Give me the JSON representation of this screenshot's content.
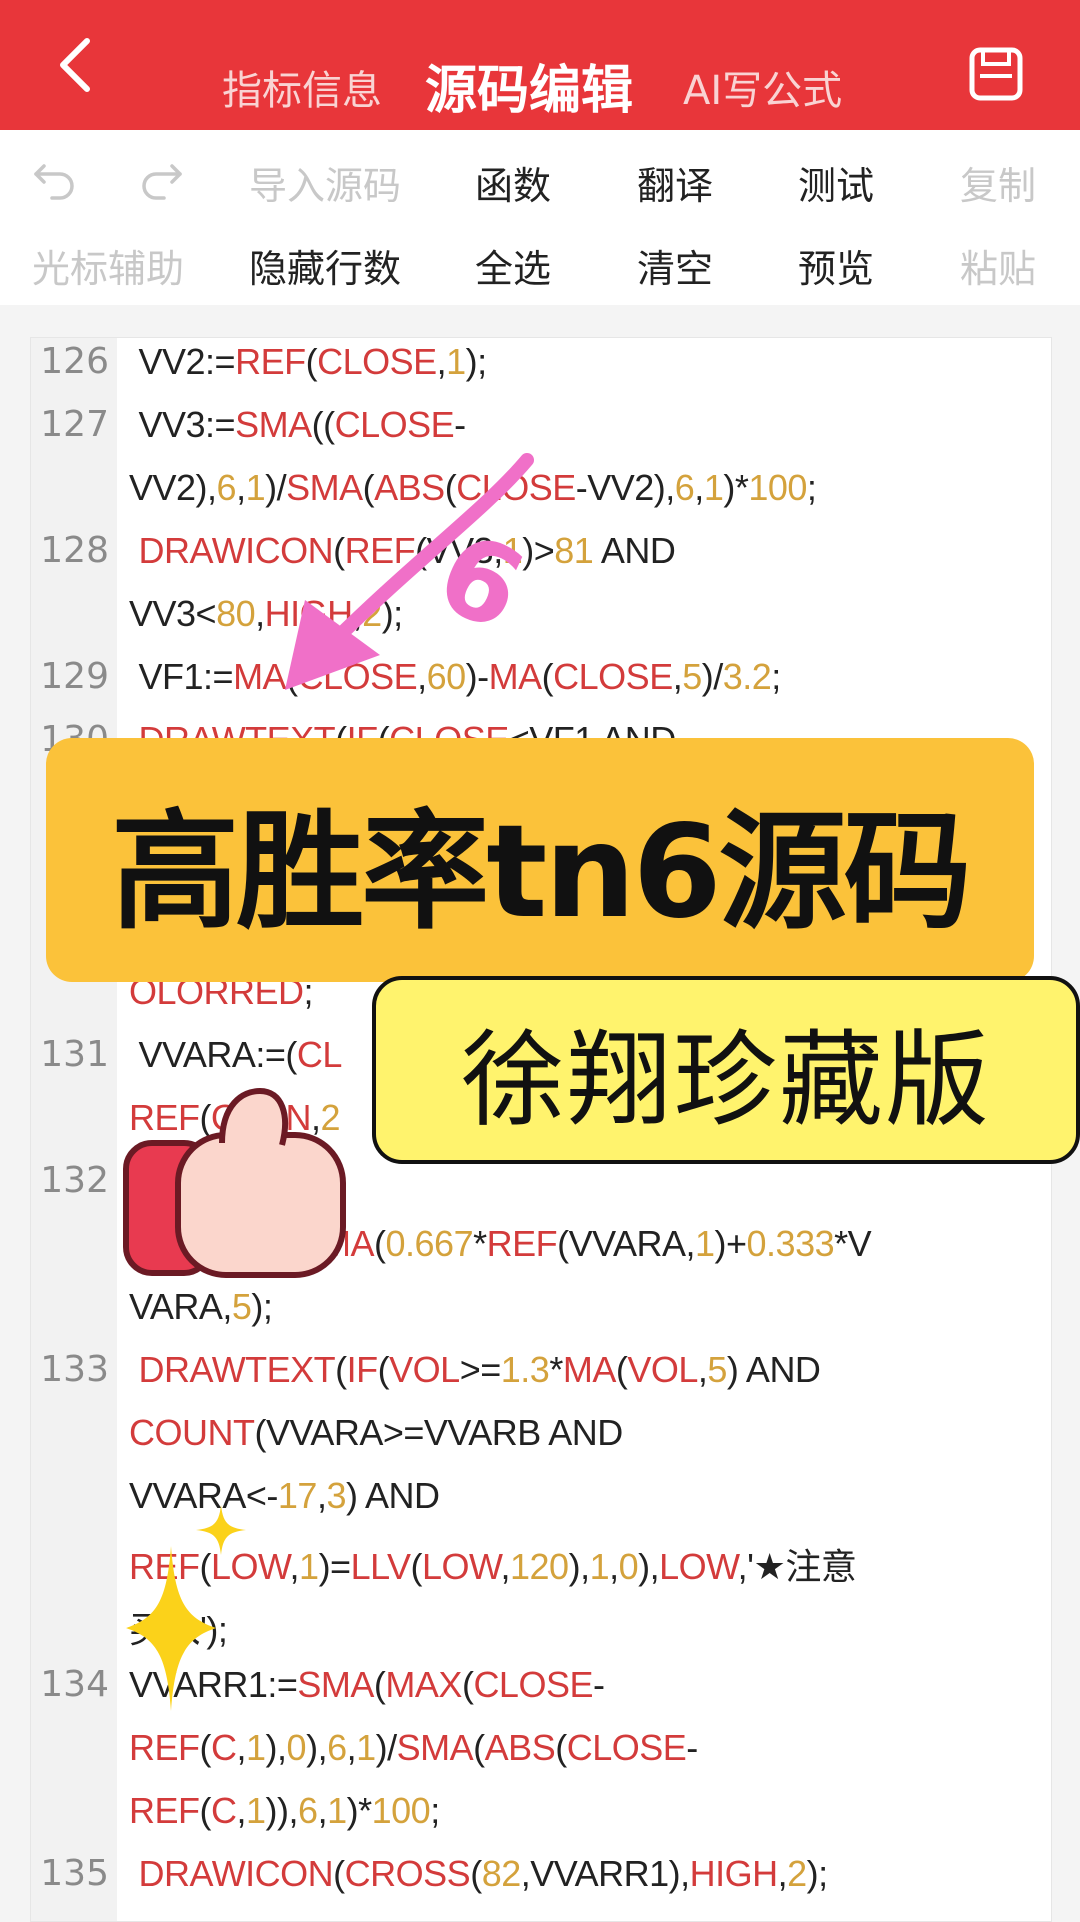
{
  "header": {
    "tabs": [
      "指标信息",
      "源码编辑",
      "AI写公式"
    ]
  },
  "toolbar": {
    "row1": [
      "导入源码",
      "函数",
      "翻译",
      "测试",
      "复制"
    ],
    "row2": [
      "光标辅助",
      "隐藏行数",
      "全选",
      "清空",
      "预览",
      "粘贴"
    ]
  },
  "editor": {
    "line_numbers": [
      "126",
      "127",
      "128",
      "129",
      "130",
      "131",
      "132",
      "133",
      "134",
      "135"
    ],
    "lines": [
      " VV2:=REF(CLOSE,1);",
      " VV3:=SMA((CLOSE-",
      "VV2),6,1)/SMA(ABS(CLOSE-VV2),6,1)*100;",
      " DRAWICON(REF(VV3,1)>81 AND",
      "VV3<80,HIGH,2);",
      " VF1:=MA(CLOSE,60)-MA(CLOSE,5)/3.2;",
      " DRAWTEXT(IF(CLOSE<VF1 AND",
      "OLORRED;",
      " VVARA:=(CL",
      "REF(OPEN,2",
      "MA(0.667*REF(VVARA,1)+0.333*V",
      "VARA,5);",
      " DRAWTEXT(IF(VOL>=1.3*MA(VOL,5) AND",
      "COUNT(VVARA>=VVARB AND",
      "VVARA<-17,3) AND",
      "REF(LOW,1)=LLV(LOW,120),1,0),LOW,'★注意",
      "买入');",
      "VVARR1:=SMA(MAX(CLOSE-",
      "REF(C,1),0),6,1)/SMA(ABS(CLOSE-",
      "REF(C,1)),6,1)*100;",
      " DRAWICON(CROSS(82,VVARR1),HIGH,2);"
    ]
  },
  "overlay": {
    "headline": "高胜率tn6源码",
    "subtitle": "徐翔珍藏版",
    "arrow_label": "6"
  },
  "colors": {
    "header_bg": "#e8363a",
    "function": "#d33b3b",
    "number": "#d4a23c",
    "banner": "#fbc23a",
    "banner2": "#fff36d"
  }
}
